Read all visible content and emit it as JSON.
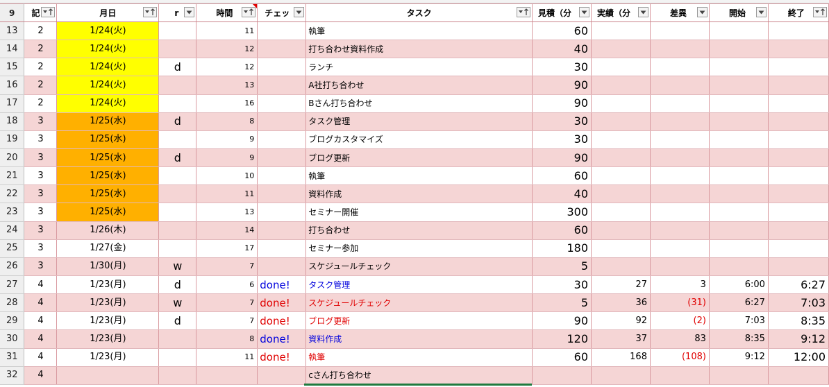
{
  "header": {
    "row_number": "9",
    "ki": "記",
    "date": "月日",
    "r": "r",
    "time": "時間",
    "check": "チェッ",
    "task": "タスク",
    "estimate": "見積（分",
    "actual": "実績（分",
    "diff": "差異",
    "start": "開始",
    "end": "終了"
  },
  "colors": {
    "date_yellow": "#ffff00",
    "date_orange": "#ffb000",
    "row_pink": "#f5d5d5",
    "done_blue": "#0000dd",
    "done_red": "#e00000"
  },
  "rows": [
    {
      "row": "13",
      "ki": "2",
      "date": "1/24(火)",
      "r": "",
      "time": "11",
      "check": "",
      "task": "執筆",
      "est": "60",
      "act": "",
      "diff": "",
      "start": "",
      "end": "",
      "bg": "white",
      "date_bg": "yellow",
      "color": ""
    },
    {
      "row": "14",
      "ki": "2",
      "date": "1/24(火)",
      "r": "",
      "time": "12",
      "check": "",
      "task": "打ち合わせ資料作成",
      "est": "40",
      "act": "",
      "diff": "",
      "start": "",
      "end": "",
      "bg": "pink",
      "date_bg": "yellow",
      "color": ""
    },
    {
      "row": "15",
      "ki": "2",
      "date": "1/24(火)",
      "r": "d",
      "time": "12",
      "check": "",
      "task": "ランチ",
      "est": "30",
      "act": "",
      "diff": "",
      "start": "",
      "end": "",
      "bg": "white",
      "date_bg": "yellow",
      "color": ""
    },
    {
      "row": "16",
      "ki": "2",
      "date": "1/24(火)",
      "r": "",
      "time": "13",
      "check": "",
      "task": "A社打ち合わせ",
      "est": "90",
      "act": "",
      "diff": "",
      "start": "",
      "end": "",
      "bg": "pink",
      "date_bg": "yellow",
      "color": ""
    },
    {
      "row": "17",
      "ki": "2",
      "date": "1/24(火)",
      "r": "",
      "time": "16",
      "check": "",
      "task": "Bさん打ち合わせ",
      "est": "90",
      "act": "",
      "diff": "",
      "start": "",
      "end": "",
      "bg": "white",
      "date_bg": "yellow",
      "color": ""
    },
    {
      "row": "18",
      "ki": "3",
      "date": "1/25(水)",
      "r": "d",
      "time": "8",
      "check": "",
      "task": "タスク管理",
      "est": "30",
      "act": "",
      "diff": "",
      "start": "",
      "end": "",
      "bg": "pink",
      "date_bg": "orange",
      "color": ""
    },
    {
      "row": "19",
      "ki": "3",
      "date": "1/25(水)",
      "r": "",
      "time": "9",
      "check": "",
      "task": "ブログカスタマイズ",
      "est": "30",
      "act": "",
      "diff": "",
      "start": "",
      "end": "",
      "bg": "white",
      "date_bg": "orange",
      "color": ""
    },
    {
      "row": "20",
      "ki": "3",
      "date": "1/25(水)",
      "r": "d",
      "time": "9",
      "check": "",
      "task": "ブログ更新",
      "est": "90",
      "act": "",
      "diff": "",
      "start": "",
      "end": "",
      "bg": "pink",
      "date_bg": "orange",
      "color": ""
    },
    {
      "row": "21",
      "ki": "3",
      "date": "1/25(水)",
      "r": "",
      "time": "10",
      "check": "",
      "task": "執筆",
      "est": "60",
      "act": "",
      "diff": "",
      "start": "",
      "end": "",
      "bg": "white",
      "date_bg": "orange",
      "color": ""
    },
    {
      "row": "22",
      "ki": "3",
      "date": "1/25(水)",
      "r": "",
      "time": "11",
      "check": "",
      "task": "資料作成",
      "est": "40",
      "act": "",
      "diff": "",
      "start": "",
      "end": "",
      "bg": "pink",
      "date_bg": "orange",
      "color": ""
    },
    {
      "row": "23",
      "ki": "3",
      "date": "1/25(水)",
      "r": "",
      "time": "13",
      "check": "",
      "task": "セミナー開催",
      "est": "300",
      "act": "",
      "diff": "",
      "start": "",
      "end": "",
      "bg": "white",
      "date_bg": "orange",
      "color": ""
    },
    {
      "row": "24",
      "ki": "3",
      "date": "1/26(木)",
      "r": "",
      "time": "14",
      "check": "",
      "task": "打ち合わせ",
      "est": "60",
      "act": "",
      "diff": "",
      "start": "",
      "end": "",
      "bg": "pink",
      "date_bg": "",
      "color": ""
    },
    {
      "row": "25",
      "ki": "3",
      "date": "1/27(金)",
      "r": "",
      "time": "17",
      "check": "",
      "task": "セミナー参加",
      "est": "180",
      "act": "",
      "diff": "",
      "start": "",
      "end": "",
      "bg": "white",
      "date_bg": "",
      "color": ""
    },
    {
      "row": "26",
      "ki": "3",
      "date": "1/30(月)",
      "r": "w",
      "time": "7",
      "check": "",
      "task": "スケジュールチェック",
      "est": "5",
      "act": "",
      "diff": "",
      "start": "",
      "end": "",
      "bg": "pink",
      "date_bg": "",
      "color": ""
    },
    {
      "row": "27",
      "ki": "4",
      "date": "1/23(月)",
      "r": "d",
      "time": "6",
      "check": "done!",
      "task": "タスク管理",
      "est": "30",
      "act": "27",
      "diff": "3",
      "start": "6:00",
      "end": "6:27",
      "bg": "white",
      "date_bg": "",
      "color": "blue",
      "diff_red": false
    },
    {
      "row": "28",
      "ki": "4",
      "date": "1/23(月)",
      "r": "w",
      "time": "7",
      "check": "done!",
      "task": "スケジュールチェック",
      "est": "5",
      "act": "36",
      "diff": "(31)",
      "start": "6:27",
      "end": "7:03",
      "bg": "pink",
      "date_bg": "",
      "color": "red",
      "diff_red": true
    },
    {
      "row": "29",
      "ki": "4",
      "date": "1/23(月)",
      "r": "d",
      "time": "7",
      "check": "done!",
      "task": "ブログ更新",
      "est": "90",
      "act": "92",
      "diff": "(2)",
      "start": "7:03",
      "end": "8:35",
      "bg": "white",
      "date_bg": "",
      "color": "red",
      "diff_red": true
    },
    {
      "row": "30",
      "ki": "4",
      "date": "1/23(月)",
      "r": "",
      "time": "8",
      "check": "done!",
      "task": "資料作成",
      "est": "120",
      "act": "37",
      "diff": "83",
      "start": "8:35",
      "end": "9:12",
      "bg": "pink",
      "date_bg": "",
      "color": "blue",
      "diff_red": false
    },
    {
      "row": "31",
      "ki": "4",
      "date": "1/23(月)",
      "r": "",
      "time": "11",
      "check": "done!",
      "task": "執筆",
      "est": "60",
      "act": "168",
      "diff": "(108)",
      "start": "9:12",
      "end": "12:00",
      "bg": "white",
      "date_bg": "",
      "color": "red",
      "diff_red": true
    },
    {
      "row": "32",
      "ki": "4",
      "date": "",
      "r": "",
      "time": "",
      "check": "",
      "task": "cさん打ち合わせ",
      "est": "",
      "act": "",
      "diff": "",
      "start": "",
      "end": "",
      "bg": "pink",
      "date_bg": "",
      "color": ""
    }
  ]
}
